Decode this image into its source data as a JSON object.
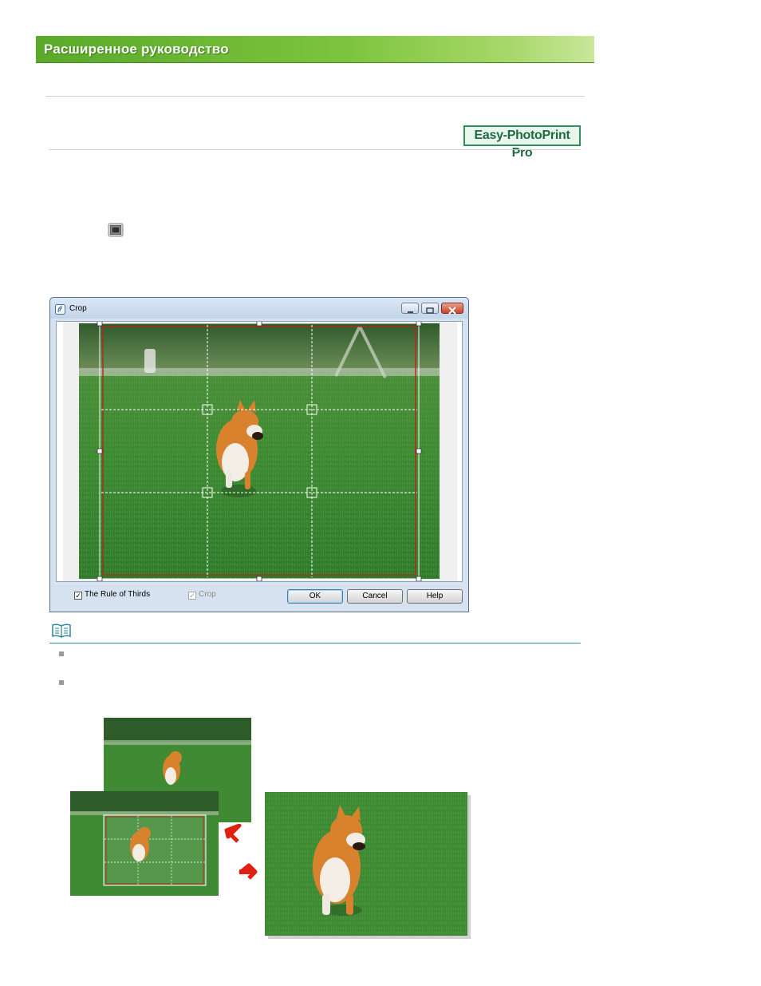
{
  "banner": {
    "title": "Расширенное руководство"
  },
  "product_badge": {
    "label": "Easy-PhotoPrint Pro"
  },
  "crop_dialog": {
    "title": "Crop",
    "rule_of_thirds": {
      "label": "The Rule of Thirds",
      "checked": true
    },
    "crop_option": {
      "label": "Crop",
      "checked": true,
      "enabled": false
    },
    "buttons": {
      "ok": "OK",
      "cancel": "Cancel",
      "help": "Help"
    },
    "window_buttons": [
      "minimize",
      "maximize",
      "close"
    ]
  },
  "icons": {
    "crop_tool": "crop-icon",
    "note": "note-book-icon",
    "arrows": "red-arrow-icon"
  },
  "colors": {
    "banner_green": "#6fb834",
    "badge_border": "#2f8f5a",
    "crop_frame": "#b42a18",
    "note_rule": "#2f8aa0",
    "arrow_red": "#e02010"
  }
}
